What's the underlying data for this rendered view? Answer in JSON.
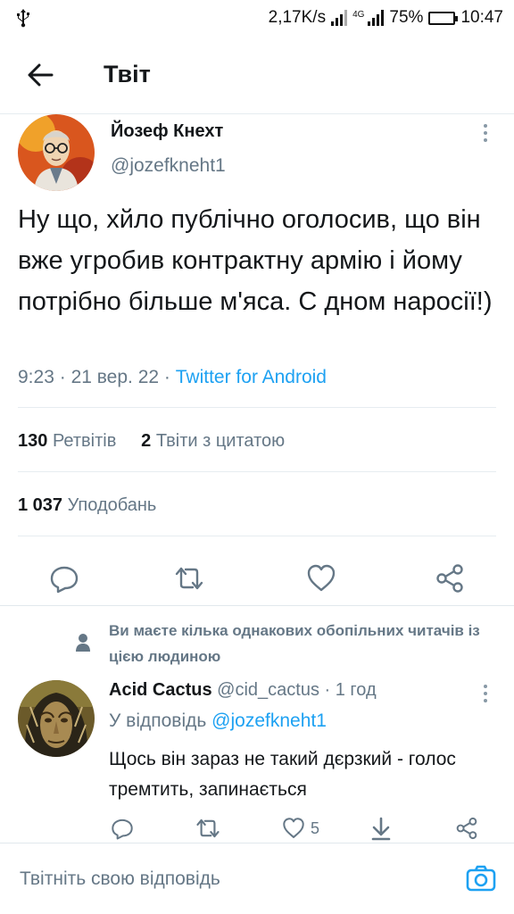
{
  "status_bar": {
    "net_speed": "2,17K/s",
    "network_type": "4G",
    "battery": "75%",
    "battery_level": 0.75,
    "time": "10:47"
  },
  "header": {
    "title": "Твіт"
  },
  "tweet": {
    "author_name": "Йозеф Кнехт",
    "author_handle": "@jozefkneht1",
    "text": "Ну що, хйло публічно оголосив, що він вже угробив контрактну армію і йому потрібно більше м'яса. С дном наросії!)",
    "time": "9:23",
    "date": "21 вер. 22",
    "separator": "·",
    "source": "Twitter for Android",
    "retweets_count": "130",
    "retweets_label": "Ретвітів",
    "quotes_count": "2",
    "quotes_label": "Твіти з цитатою",
    "likes_count": "1 037",
    "likes_label": "Уподобань"
  },
  "reply_context": {
    "text": "Ви маєте кілька однакових обопільних читачів із цією людиною"
  },
  "reply": {
    "name": "Acid Cactus",
    "handle": "@cid_cactus",
    "dot": "·",
    "time": "1 год",
    "reply_to_label": "У відповідь",
    "reply_to_mention": "@jozefkneht1",
    "text": "Щось він зараз не такий дєрзкий - голос тремтить, запинається",
    "likes_count": "5"
  },
  "compose": {
    "placeholder": "Твітніть свою відповідь"
  },
  "colors": {
    "accent": "#1da1f2",
    "secondary_text": "#657786",
    "divider": "#e6ecf0",
    "battery": "#2db334"
  },
  "icons": [
    "usb-icon",
    "signal-icon",
    "battery-icon",
    "back-arrow-icon",
    "more-icon",
    "reply-icon",
    "retweet-icon",
    "like-icon",
    "share-icon",
    "person-icon",
    "download-icon",
    "camera-icon"
  ]
}
